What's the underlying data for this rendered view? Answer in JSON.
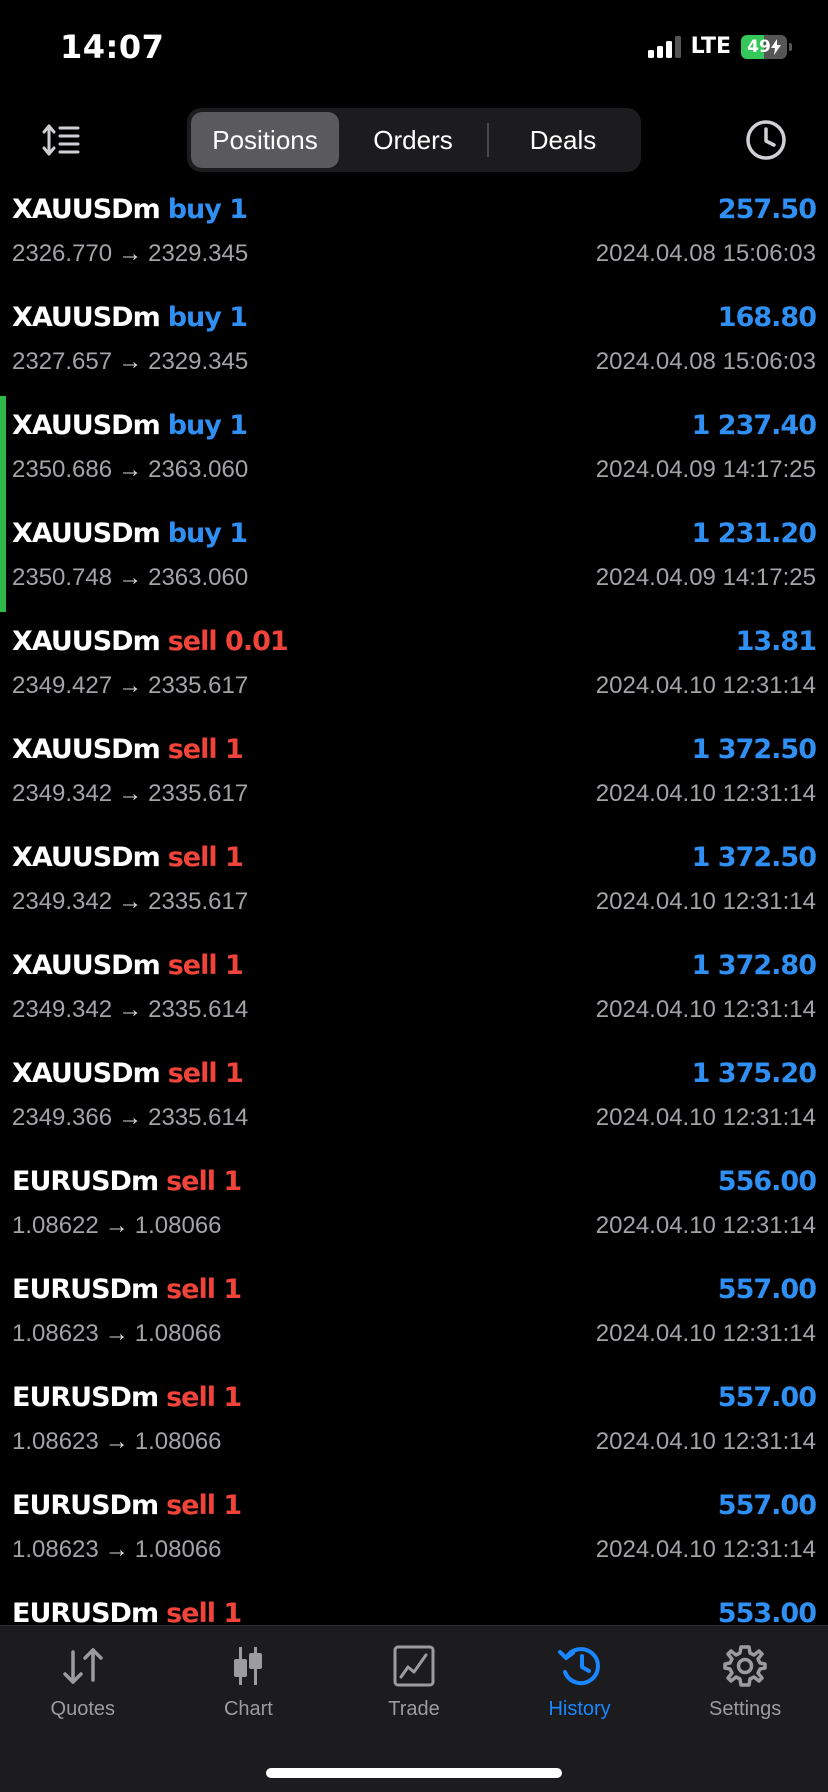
{
  "status_bar": {
    "time": "14:07",
    "network": "LTE",
    "battery_percent": "49",
    "battery_level": 0.49,
    "battery_color": "#34c759"
  },
  "toolbar": {
    "sort_icon": "sort-lines-icon",
    "segments": [
      {
        "label": "Positions",
        "active": true
      },
      {
        "label": "Orders",
        "active": false
      },
      {
        "label": "Deals",
        "active": false
      }
    ],
    "period_icon": "clock-icon"
  },
  "colors": {
    "buy": "#2f8ff2",
    "sell": "#f0443a",
    "profit": "#2f8ff2",
    "accent_bar": "#2fb84a",
    "tab_active": "#1a86ff"
  },
  "trades": [
    {
      "symbol": "XAUUSDm",
      "side": "buy 1",
      "type": "buy",
      "open": "2326.770",
      "arrow": "→",
      "close": "2329.345",
      "profit": "257.50",
      "time": "2024.04.08 15:06:03",
      "highlight": false
    },
    {
      "symbol": "XAUUSDm",
      "side": "buy 1",
      "type": "buy",
      "open": "2327.657",
      "arrow": "→",
      "close": "2329.345",
      "profit": "168.80",
      "time": "2024.04.08 15:06:03",
      "highlight": false
    },
    {
      "symbol": "XAUUSDm",
      "side": "buy 1",
      "type": "buy",
      "open": "2350.686",
      "arrow": "→",
      "close": "2363.060",
      "profit": "1 237.40",
      "time": "2024.04.09 14:17:25",
      "highlight": true
    },
    {
      "symbol": "XAUUSDm",
      "side": "buy 1",
      "type": "buy",
      "open": "2350.748",
      "arrow": "→",
      "close": "2363.060",
      "profit": "1 231.20",
      "time": "2024.04.09 14:17:25",
      "highlight": true
    },
    {
      "symbol": "XAUUSDm",
      "side": "sell 0.01",
      "type": "sell",
      "open": "2349.427",
      "arrow": "→",
      "close": "2335.617",
      "profit": "13.81",
      "time": "2024.04.10 12:31:14",
      "highlight": false
    },
    {
      "symbol": "XAUUSDm",
      "side": "sell 1",
      "type": "sell",
      "open": "2349.342",
      "arrow": "→",
      "close": "2335.617",
      "profit": "1 372.50",
      "time": "2024.04.10 12:31:14",
      "highlight": false
    },
    {
      "symbol": "XAUUSDm",
      "side": "sell 1",
      "type": "sell",
      "open": "2349.342",
      "arrow": "→",
      "close": "2335.617",
      "profit": "1 372.50",
      "time": "2024.04.10 12:31:14",
      "highlight": false
    },
    {
      "symbol": "XAUUSDm",
      "side": "sell 1",
      "type": "sell",
      "open": "2349.342",
      "arrow": "→",
      "close": "2335.614",
      "profit": "1 372.80",
      "time": "2024.04.10 12:31:14",
      "highlight": false
    },
    {
      "symbol": "XAUUSDm",
      "side": "sell 1",
      "type": "sell",
      "open": "2349.366",
      "arrow": "→",
      "close": "2335.614",
      "profit": "1 375.20",
      "time": "2024.04.10 12:31:14",
      "highlight": false
    },
    {
      "symbol": "EURUSDm",
      "side": "sell 1",
      "type": "sell",
      "open": "1.08622",
      "arrow": "→",
      "close": "1.08066",
      "profit": "556.00",
      "time": "2024.04.10 12:31:14",
      "highlight": false
    },
    {
      "symbol": "EURUSDm",
      "side": "sell 1",
      "type": "sell",
      "open": "1.08623",
      "arrow": "→",
      "close": "1.08066",
      "profit": "557.00",
      "time": "2024.04.10 12:31:14",
      "highlight": false
    },
    {
      "symbol": "EURUSDm",
      "side": "sell 1",
      "type": "sell",
      "open": "1.08623",
      "arrow": "→",
      "close": "1.08066",
      "profit": "557.00",
      "time": "2024.04.10 12:31:14",
      "highlight": false
    },
    {
      "symbol": "EURUSDm",
      "side": "sell 1",
      "type": "sell",
      "open": "1.08623",
      "arrow": "→",
      "close": "1.08066",
      "profit": "557.00",
      "time": "2024.04.10 12:31:14",
      "highlight": false
    },
    {
      "symbol": "EURUSDm",
      "side": "sell 1",
      "type": "sell",
      "open": "",
      "arrow": "",
      "close": "",
      "profit": "553.00",
      "time": "",
      "highlight": false
    }
  ],
  "tab_bar": {
    "tabs": [
      {
        "label": "Quotes",
        "icon": "quotes-arrows-icon",
        "active": false
      },
      {
        "label": "Chart",
        "icon": "candlestick-chart-icon",
        "active": false
      },
      {
        "label": "Trade",
        "icon": "trade-chart-icon",
        "active": false
      },
      {
        "label": "History",
        "icon": "history-icon",
        "active": true
      },
      {
        "label": "Settings",
        "icon": "gear-icon",
        "active": false
      }
    ]
  }
}
